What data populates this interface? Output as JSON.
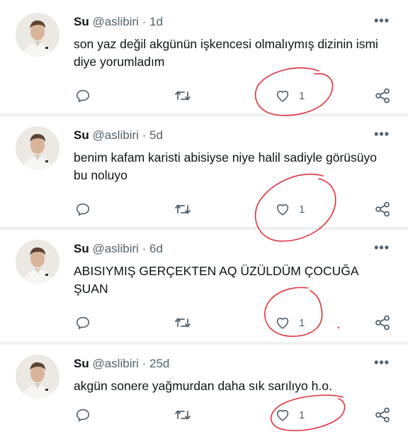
{
  "tweets": [
    {
      "name": "Su",
      "handle": "@aslibiri",
      "time": "· 1d",
      "text": "son yaz değil akgünün işkencesi olmalıymış dizinin ismi diye yorumladım",
      "likes": "1"
    },
    {
      "name": "Su",
      "handle": "@aslibiri",
      "time": "· 5d",
      "text": "benim kafam karisti abisiyse niye halil sadiyle görüsüyo bu noluyo",
      "likes": "1"
    },
    {
      "name": "Su",
      "handle": "@aslibiri",
      "time": "· 6d",
      "text": "ABISIYMIŞ GERÇEKTEN AQ ÜZÜLDÜM ÇOCUĞA ŞUAN",
      "likes": "1"
    },
    {
      "name": "Su",
      "handle": "@aslibiri",
      "time": "· 25d",
      "text": "akgün sonere yağmurdan daha sık sarılıyo h.o.",
      "likes": "1"
    }
  ],
  "more_label": "•••",
  "icons": {
    "reply": "reply-icon",
    "retweet": "retweet-icon",
    "like": "heart-icon",
    "share": "share-icon",
    "more": "more-icon"
  },
  "colors": {
    "text": "#0f1419",
    "secondary": "#536471",
    "annotation": "#e0313a"
  }
}
